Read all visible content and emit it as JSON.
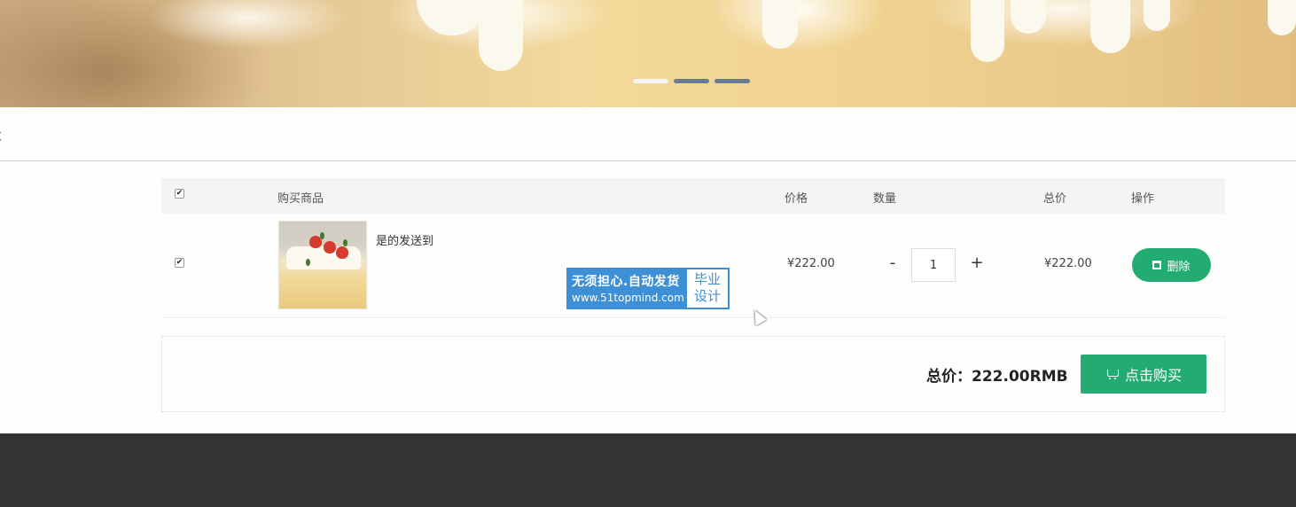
{
  "breadcrumb": {
    "text": "车"
  },
  "banner": {
    "slides": 3,
    "active_slide": 1
  },
  "table": {
    "headers": {
      "product": "购买商品",
      "price": "价格",
      "quantity": "数量",
      "total": "总价",
      "action": "操作"
    },
    "select_all_checked": true,
    "rows": [
      {
        "checked": true,
        "name": "是的发送到",
        "price": "¥222.00",
        "quantity": "1",
        "subtotal": "¥222.00",
        "delete_label": "删除"
      }
    ]
  },
  "watermark": {
    "line1": "无须担心.自动发货",
    "line2": "www.51topmind.com",
    "badge1": "毕业",
    "badge2": "设计"
  },
  "qty": {
    "minus": "-",
    "plus": "+"
  },
  "summary": {
    "total_label": "总价：222.00RMB",
    "buy_label": "点击购买"
  },
  "icons": {
    "checkbox": "checkbox-icon",
    "delete": "trash-icon",
    "buy": "cart-icon"
  },
  "colors": {
    "accent": "#22ac72",
    "footer": "#333332"
  }
}
